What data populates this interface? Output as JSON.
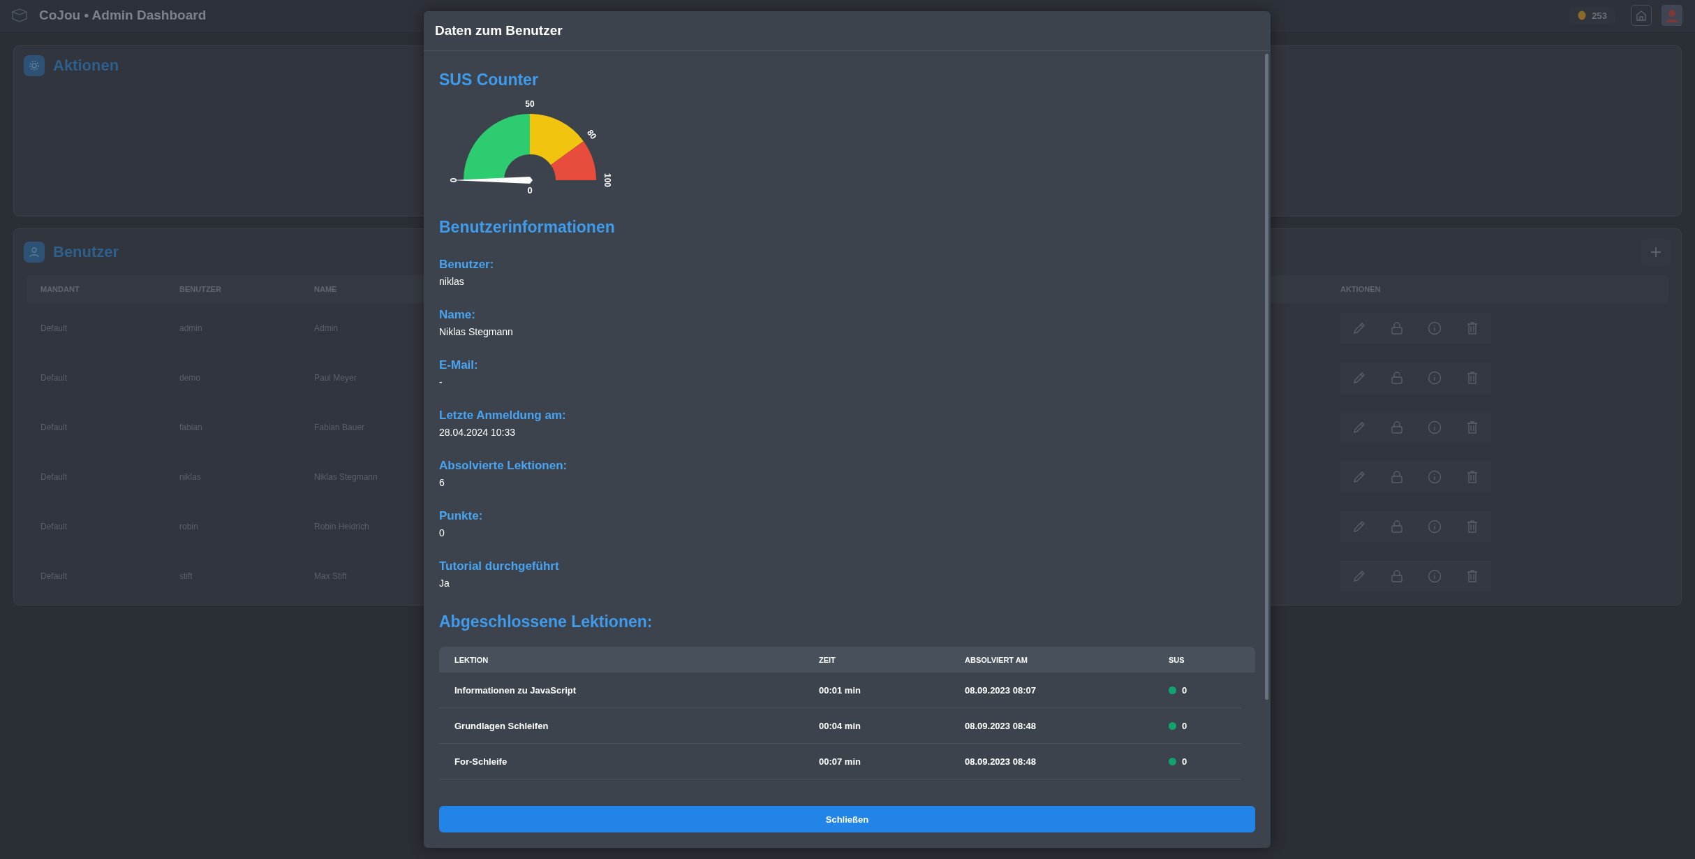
{
  "app": {
    "title": "CoJou • Admin Dashboard",
    "coins": "253"
  },
  "actions_card": {
    "title": "Aktionen"
  },
  "users_card": {
    "title": "Benutzer",
    "columns": [
      "MANDANT",
      "BENUTZER",
      "NAME",
      "AKTIONEN"
    ],
    "rows": [
      {
        "mandant": "Default",
        "user": "admin",
        "name": "Admin",
        "locked": true
      },
      {
        "mandant": "Default",
        "user": "demo",
        "name": "Paul Meyer",
        "locked": false
      },
      {
        "mandant": "Default",
        "user": "fabian",
        "name": "Fabian Bauer",
        "locked": true
      },
      {
        "mandant": "Default",
        "user": "niklas",
        "name": "Niklas Stegmann",
        "locked": true
      },
      {
        "mandant": "Default",
        "user": "robin",
        "name": "Robin Heidrich",
        "locked": true
      },
      {
        "mandant": "Default",
        "user": "stift",
        "name": "Max Stift",
        "locked": true
      }
    ]
  },
  "dialog": {
    "title": "Daten zum Benutzer",
    "sus_title": "SUS Counter",
    "gauge": {
      "ticks": [
        "0",
        "50",
        "80",
        "100"
      ],
      "value": "0"
    },
    "info_title": "Benutzerinformationen",
    "fields": [
      {
        "label": "Benutzer:",
        "value": "niklas"
      },
      {
        "label": "Name:",
        "value": "Niklas Stegmann"
      },
      {
        "label": "E-Mail:",
        "value": "-"
      },
      {
        "label": "Letzte Anmeldung am:",
        "value": "28.04.2024 10:33"
      },
      {
        "label": "Absolvierte Lektionen:",
        "value": "6"
      },
      {
        "label": "Punkte:",
        "value": "0"
      },
      {
        "label": "Tutorial durchgeführt",
        "value": "Ja"
      }
    ],
    "lessons_title": "Abgeschlossene Lektionen:",
    "lessons": {
      "columns": [
        "LEKTION",
        "ZEIT",
        "ABSOLVIERT AM",
        "SUS"
      ],
      "rows": [
        {
          "lesson": "Informationen zu JavaScript",
          "time": "00:01 min",
          "completed": "08.09.2023 08:07",
          "sus": "0",
          "color": "#10a36e"
        },
        {
          "lesson": "Grundlagen Schleifen",
          "time": "00:04 min",
          "completed": "08.09.2023 08:48",
          "sus": "0",
          "color": "#10a36e"
        },
        {
          "lesson": "For-Schleife",
          "time": "00:07 min",
          "completed": "08.09.2023 08:48",
          "sus": "0",
          "color": "#10a36e"
        }
      ]
    },
    "close_button": "Schließen"
  }
}
